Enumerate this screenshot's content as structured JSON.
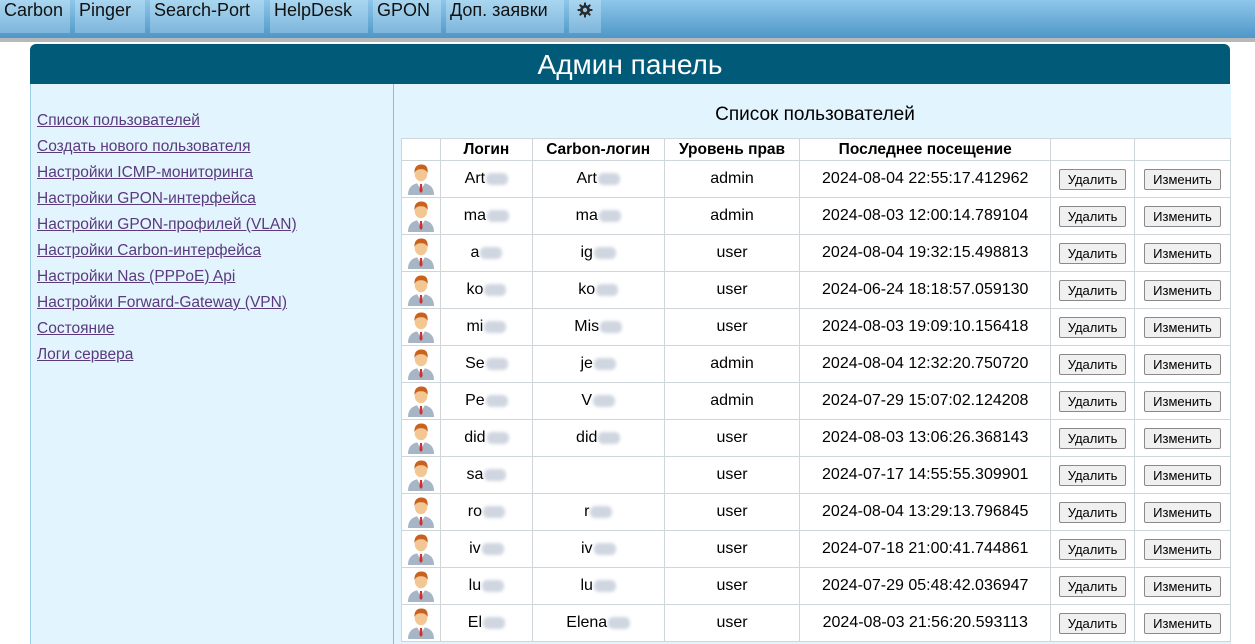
{
  "nav": {
    "tabs": [
      "Carbon",
      "Pinger",
      "Search-Port",
      "HelpDesk",
      "GPON",
      "Доп. заявки"
    ],
    "settings_icon": "gear-icon"
  },
  "panel": {
    "title": "Админ панель"
  },
  "sidebar": {
    "links": [
      "Список пользователей",
      "Создать нового пользователя",
      "Настройки ICMP-мониторинга",
      "Настройки GPON-интерфейса",
      "Настройки GPON-профилей (VLAN)",
      "Настройки Carbon-интерфейса",
      "Настройки Nas (PPPoE) Api",
      "Настройки Forward-Gateway (VPN)",
      "Состояние",
      "Логи сервера"
    ]
  },
  "users_table": {
    "title": "Список пользователей",
    "columns": [
      "",
      "Логин",
      "Carbon-логин",
      "Уровень прав",
      "Последнее посещение",
      "",
      ""
    ],
    "delete_label": "Удалить",
    "edit_label": "Изменить",
    "avatar_icon": "user-avatar-icon",
    "rows": [
      {
        "login": "Art",
        "carbon_login": "Art",
        "role": "admin",
        "last_visit": "2024-08-04 22:55:17.412962"
      },
      {
        "login": "ma",
        "carbon_login": "ma",
        "role": "admin",
        "last_visit": "2024-08-03 12:00:14.789104"
      },
      {
        "login": "a",
        "carbon_login": "ig",
        "role": "user",
        "last_visit": "2024-08-04 19:32:15.498813"
      },
      {
        "login": "ko",
        "carbon_login": "ko",
        "role": "user",
        "last_visit": "2024-06-24 18:18:57.059130"
      },
      {
        "login": "mi",
        "carbon_login": "Mis",
        "role": "user",
        "last_visit": "2024-08-03 19:09:10.156418"
      },
      {
        "login": "Se",
        "carbon_login": "je",
        "role": "admin",
        "last_visit": "2024-08-04 12:32:20.750720"
      },
      {
        "login": "Pe",
        "carbon_login": "V",
        "role": "admin",
        "last_visit": "2024-07-29 15:07:02.124208"
      },
      {
        "login": "did",
        "carbon_login": "did",
        "role": "user",
        "last_visit": "2024-08-03 13:06:26.368143"
      },
      {
        "login": "sa",
        "carbon_login": "",
        "role": "user",
        "last_visit": "2024-07-17 14:55:55.309901"
      },
      {
        "login": "ro",
        "carbon_login": "r",
        "role": "user",
        "last_visit": "2024-08-04 13:29:13.796845"
      },
      {
        "login": "iv",
        "carbon_login": "iv",
        "role": "user",
        "last_visit": "2024-07-18 21:00:41.744861"
      },
      {
        "login": "lu",
        "carbon_login": "lu",
        "role": "user",
        "last_visit": "2024-07-29 05:48:42.036947"
      },
      {
        "login": "El",
        "carbon_login": "Elena",
        "role": "user",
        "last_visit": "2024-08-03 21:56:20.593113"
      }
    ]
  }
}
